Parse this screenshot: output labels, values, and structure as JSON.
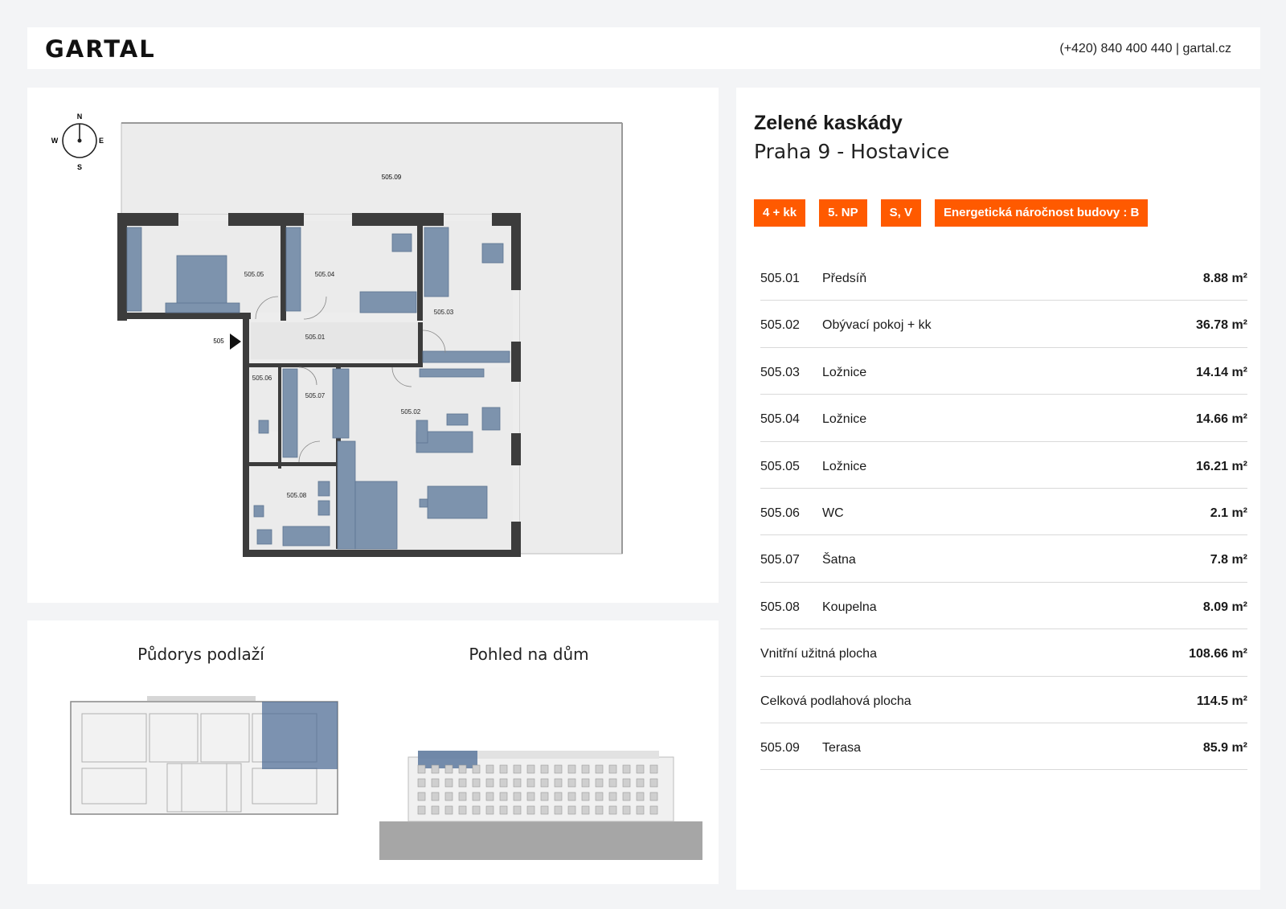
{
  "header": {
    "logo": "GARTAL",
    "contact": "(+420) 840 400 440 | gartal.cz"
  },
  "project": {
    "name": "Zelené kaskády",
    "location": "Praha 9 - Hostavice"
  },
  "badges": [
    "4 + kk",
    "5. NP",
    "S, V",
    "Energetická náročnost budovy : B"
  ],
  "rooms": [
    {
      "code": "505.01",
      "name": "Předsíň",
      "area": "8.88 m²"
    },
    {
      "code": "505.02",
      "name": "Obývací pokoj + kk",
      "area": "36.78 m²"
    },
    {
      "code": "505.03",
      "name": "Ložnice",
      "area": "14.14 m²"
    },
    {
      "code": "505.04",
      "name": "Ložnice",
      "area": "14.66 m²"
    },
    {
      "code": "505.05",
      "name": "Ložnice",
      "area": "16.21 m²"
    },
    {
      "code": "505.06",
      "name": "WC",
      "area": "2.1 m²"
    },
    {
      "code": "505.07",
      "name": "Šatna",
      "area": "7.8 m²"
    },
    {
      "code": "505.08",
      "name": "Koupelna",
      "area": "8.09 m²"
    },
    {
      "code": "",
      "name": "Vnitřní užitná plocha",
      "area": "108.66 m²"
    },
    {
      "code": "",
      "name": "Celková podlahová plocha",
      "area": "114.5 m²"
    },
    {
      "code": "505.09",
      "name": "Terasa",
      "area": "85.9 m²"
    }
  ],
  "floorplan": {
    "compass": {
      "n": "N",
      "s": "S",
      "e": "E",
      "w": "W"
    },
    "entrance": "505",
    "labels": {
      "r01": "505.01",
      "r02": "505.02",
      "r03": "505.03",
      "r04": "505.04",
      "r05": "505.05",
      "r06": "505.06",
      "r07": "505.07",
      "r08": "505.08",
      "r09": "505.09"
    }
  },
  "thumbnails": {
    "floor_title": "Půdorys podlaží",
    "house_title": "Pohled na dům"
  },
  "colors": {
    "accent": "#ff5a00",
    "furniture": "#7d93ad",
    "wall": "#3c3c3c",
    "terrace": "#ececec",
    "highlight": "#4a6a94"
  }
}
